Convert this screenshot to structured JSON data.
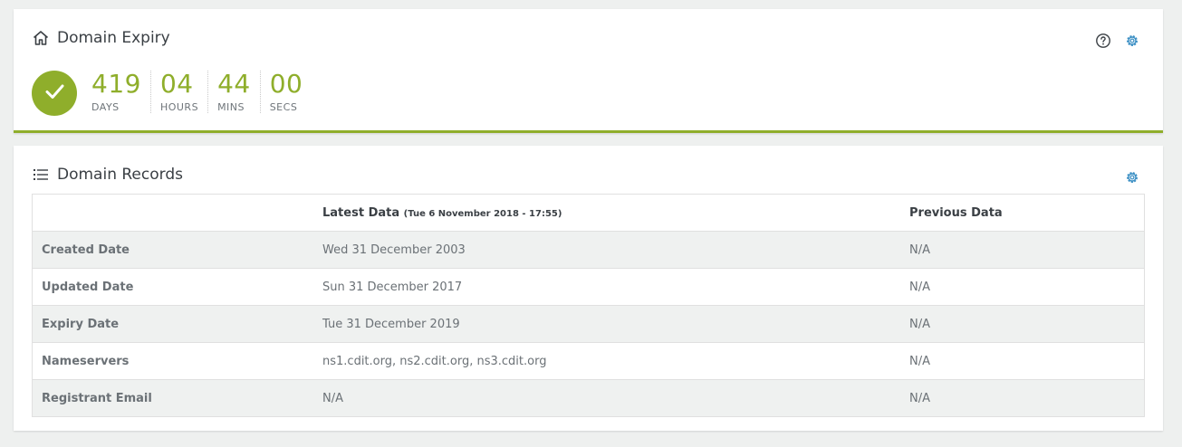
{
  "colors": {
    "accent": "#8fae2b",
    "icon_blue": "#3b8fc4",
    "text": "#3a3f44"
  },
  "expiry": {
    "title": "Domain Expiry",
    "title_icon": "home-icon",
    "status_icon": "check-icon",
    "countdown": [
      {
        "value": "419",
        "label": "DAYS"
      },
      {
        "value": "04",
        "label": "HOURS"
      },
      {
        "value": "44",
        "label": "MINS"
      },
      {
        "value": "00",
        "label": "SECS"
      }
    ]
  },
  "records": {
    "title": "Domain Records",
    "title_icon": "list-icon",
    "columns": {
      "latest_label": "Latest Data",
      "latest_timestamp": "(Tue 6 November 2018 - 17:55)",
      "previous_label": "Previous Data"
    },
    "rows": [
      {
        "label": "Created Date",
        "latest": "Wed 31 December 2003",
        "previous": "N/A"
      },
      {
        "label": "Updated Date",
        "latest": "Sun 31 December 2017",
        "previous": "N/A"
      },
      {
        "label": "Expiry Date",
        "latest": "Tue 31 December 2019",
        "previous": "N/A"
      },
      {
        "label": "Nameservers",
        "latest": "ns1.cdit.org, ns2.cdit.org, ns3.cdit.org",
        "previous": "N/A"
      },
      {
        "label": "Registrant Email",
        "latest": "N/A",
        "previous": "N/A"
      }
    ]
  }
}
